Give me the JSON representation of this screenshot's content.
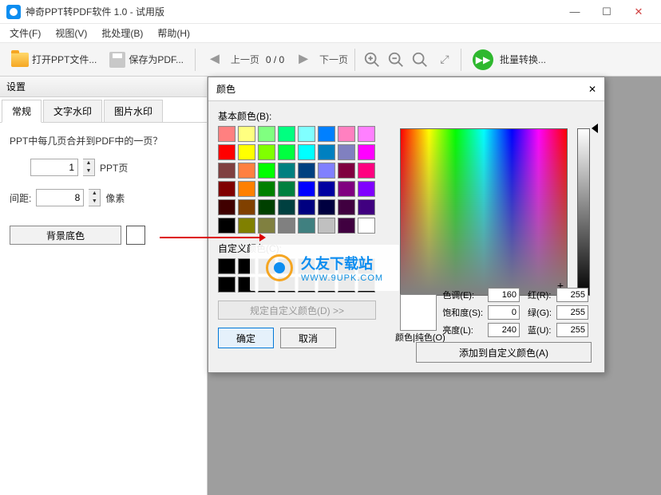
{
  "title": "神奇PPT转PDF软件 1.0 - 试用版",
  "menu": {
    "file": "文件(F)",
    "view": "视图(V)",
    "batch": "批处理(B)",
    "help": "帮助(H)"
  },
  "toolbar": {
    "open": "打开PPT文件...",
    "save": "保存为PDF...",
    "prev": "上一页",
    "pages": "0 / 0",
    "next": "下一页",
    "batch": "批量转换..."
  },
  "sidebar": {
    "title": "设置",
    "tabs": {
      "general": "常规",
      "text_wm": "文字水印",
      "img_wm": "图片水印"
    },
    "question": "PPT中每几页合并到PDF中的一页？",
    "pages_value": "1",
    "pages_unit": "PPT页",
    "gap_label": "间距:",
    "gap_value": "8",
    "gap_unit": "像素",
    "bg_color": "背景底色"
  },
  "dialog": {
    "title": "颜色",
    "basic_label": "基本颜色(B):",
    "custom_label": "自定义颜色(C):",
    "define": "规定自定义颜色(D) >>",
    "ok": "确定",
    "cancel": "取消",
    "preview": "颜色|纯色(O)",
    "hue_l": "色调(E):",
    "hue_v": "160",
    "sat_l": "饱和度(S):",
    "sat_v": "0",
    "lum_l": "亮度(L):",
    "lum_v": "240",
    "r_l": "红(R):",
    "r_v": "255",
    "g_l": "绿(G):",
    "g_v": "255",
    "b_l": "蓝(U):",
    "b_v": "255",
    "add": "添加到自定义颜色(A)"
  },
  "watermark": {
    "text": "久友下载站",
    "sub": "WWW.9UPK.COM"
  },
  "basic_colors": [
    "#ff8080",
    "#ffff80",
    "#80ff80",
    "#00ff80",
    "#80ffff",
    "#0080ff",
    "#ff80c0",
    "#ff80ff",
    "#ff0000",
    "#ffff00",
    "#80ff00",
    "#00ff40",
    "#00ffff",
    "#0080c0",
    "#8080c0",
    "#ff00ff",
    "#804040",
    "#ff8040",
    "#00ff00",
    "#008080",
    "#004080",
    "#8080ff",
    "#800040",
    "#ff0080",
    "#800000",
    "#ff8000",
    "#008000",
    "#008040",
    "#0000ff",
    "#0000a0",
    "#800080",
    "#8000ff",
    "#400000",
    "#804000",
    "#004000",
    "#004040",
    "#000080",
    "#000040",
    "#400040",
    "#400080",
    "#000000",
    "#808000",
    "#808040",
    "#808080",
    "#408080",
    "#c0c0c0",
    "#400040",
    "#ffffff"
  ]
}
